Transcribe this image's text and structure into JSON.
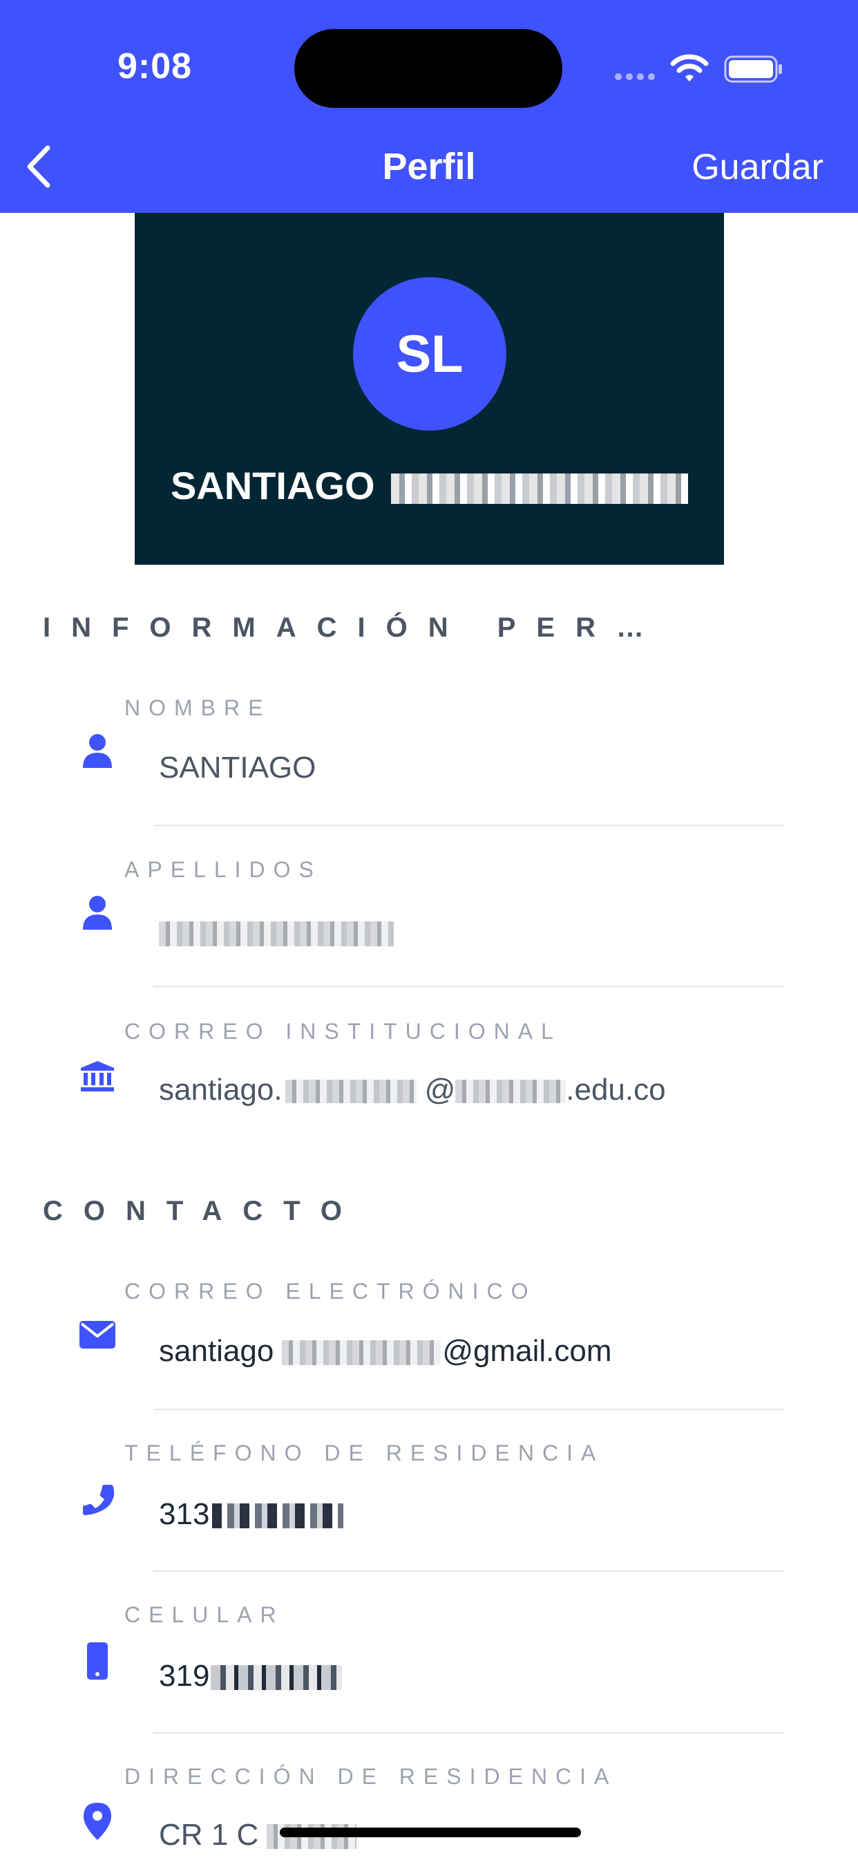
{
  "status_bar": {
    "time": "9:08"
  },
  "nav": {
    "title": "Perfil",
    "save_label": "Guardar"
  },
  "profile": {
    "initials": "SL",
    "first_name": "SANTIAGO"
  },
  "sections": {
    "personal": "INFORMACIÓN PER…",
    "contact": "CONTACTO"
  },
  "fields": {
    "nombre": {
      "label": "NOMBRE",
      "value": "SANTIAGO",
      "icon": "user-icon"
    },
    "apellidos": {
      "label": "APELLIDOS",
      "icon": "user-icon"
    },
    "correo_institucional": {
      "label": "CORREO INSTITUCIONAL",
      "prefix": "santiago.",
      "middle": "@",
      "suffix": ".edu.co",
      "icon": "institution-icon"
    },
    "correo_electronico": {
      "label": "CORREO ELECTRÓNICO",
      "prefix": "santiago",
      "suffix": "@gmail.com",
      "icon": "envelope-icon"
    },
    "telefono_residencia": {
      "label": "TELÉFONO DE RESIDENCIA",
      "prefix": "313",
      "icon": "phone-icon"
    },
    "celular": {
      "label": "CELULAR",
      "prefix": "319",
      "icon": "mobile-icon"
    },
    "direccion_residencia": {
      "label": "DIRECCIÓN DE RESIDENCIA",
      "prefix": "CR 1 C",
      "icon": "location-pin-icon"
    }
  },
  "colors": {
    "accent": "#3f52fb",
    "card_bg": "#022634",
    "label": "#9ca3af",
    "section": "#4b5563"
  }
}
